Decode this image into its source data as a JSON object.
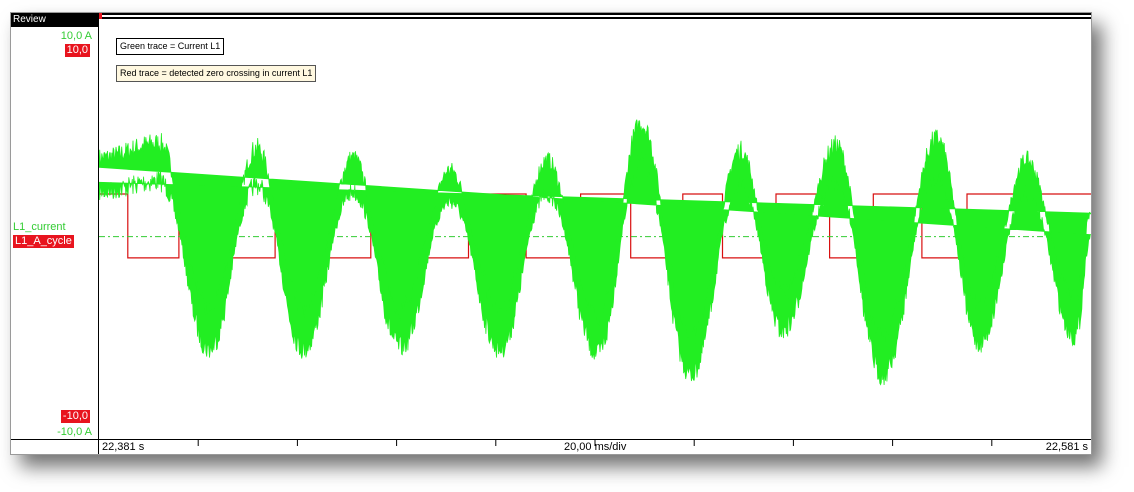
{
  "window": {
    "title": "Review"
  },
  "left_panel": {
    "ymax_label": "10,0  A",
    "ymax_box": "10,0",
    "green_channel": "L1_current",
    "red_channel": "L1_A_cycle",
    "ymin_box": "-10,0",
    "ymin_label": "-10,0  A"
  },
  "annotations": {
    "green": "Green trace = Current L1",
    "red": "Red trace = detected zero crossing in current L1"
  },
  "x_axis": {
    "start": "22,381 s",
    "division": "20,00 ms/div",
    "end": "22,581 s"
  },
  "colors": {
    "green_trace": "#22ee22",
    "red_trace": "#d81010",
    "baseline": "#33cc33",
    "label_red": "#e8141e"
  },
  "chart_data": {
    "type": "line",
    "xlim": [
      22.381,
      22.581
    ],
    "ylim": [
      -10,
      10
    ],
    "xlabel": "",
    "ylabel": "",
    "grid": false,
    "series": [
      {
        "name": "L1_current",
        "unit": "A",
        "zero_crossings": [
          22.3885,
          22.3988,
          22.4081,
          22.4178,
          22.4275,
          22.4368,
          22.4475,
          22.4573,
          22.4685,
          22.4792,
          22.4895,
          22.4999,
          22.5078,
          22.519,
          22.5297,
          22.5385,
          22.5479,
          22.5575
        ],
        "peaks": [
          {
            "x": 22.381,
            "y": 2.4
          },
          {
            "x": 22.3932,
            "y": 3.0
          },
          {
            "x": 22.4032,
            "y": -4.9
          },
          {
            "x": 22.4128,
            "y": 2.8
          },
          {
            "x": 22.4222,
            "y": -4.9
          },
          {
            "x": 22.4322,
            "y": 2.4
          },
          {
            "x": 22.4418,
            "y": -4.8
          },
          {
            "x": 22.4518,
            "y": 1.9
          },
          {
            "x": 22.4618,
            "y": -4.9
          },
          {
            "x": 22.4713,
            "y": 2.3
          },
          {
            "x": 22.4815,
            "y": -5.1
          },
          {
            "x": 22.4903,
            "y": 3.9
          },
          {
            "x": 22.5003,
            "y": -6.1
          },
          {
            "x": 22.5103,
            "y": 2.7
          },
          {
            "x": 22.5188,
            "y": -4.0
          },
          {
            "x": 22.5296,
            "y": 2.9
          },
          {
            "x": 22.5389,
            "y": -6.1
          },
          {
            "x": 22.5499,
            "y": 3.2
          },
          {
            "x": 22.5585,
            "y": -4.6
          },
          {
            "x": 22.568,
            "y": 2.3
          },
          {
            "x": 22.5778,
            "y": -4.3
          },
          {
            "x": 22.581,
            "y": 0.1
          }
        ]
      },
      {
        "name": "L1_A_cycle",
        "type": "step",
        "high": 1.5,
        "low": -1.5,
        "initial": "high",
        "edges": [
          22.3868,
          22.3971,
          22.4068,
          22.4165,
          22.4264,
          22.4358,
          22.446,
          22.4555,
          22.4671,
          22.4781,
          22.4882,
          22.4987,
          22.5067,
          22.5175,
          22.5283,
          22.5371,
          22.5469,
          22.556
        ],
        "baseline": -0.5
      }
    ]
  }
}
